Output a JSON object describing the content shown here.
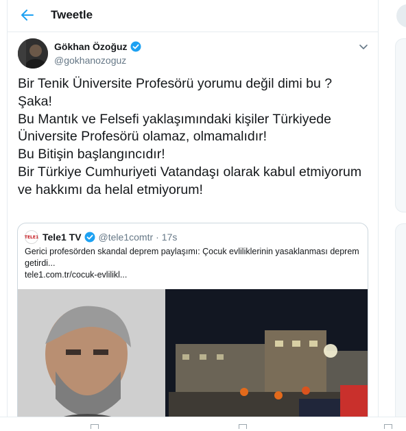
{
  "header": {
    "title": "Tweetle",
    "back_icon": "arrow-left-icon"
  },
  "tweet": {
    "author_name": "Gökhan Özoğuz",
    "author_handle": "@gokhanozoguz",
    "text": "Bir Tenik Üniversite Profesörü yorumu değil dimi bu ?\nŞaka!\nBu Mantık ve Felsefi yaklaşımındaki kişiler Türkiyede Üniversite Profesörü olamaz, olmamalıdır!\nBu Bitişin başlangıncıdır!\nBir Türkiye Cumhuriyeti Vatandaşı olarak kabul etmiyorum ve hakkımı da helal etmiyorum!"
  },
  "quote": {
    "logo_text": "TELE1",
    "name": "Tele1 TV",
    "handle": "@tele1comtr",
    "separator": "·",
    "time": "17s",
    "text": "Gerici profesörden skandal deprem paylaşımı: Çocuk evliliklerinin yasaklanması deprem getirdi...",
    "link": "tele1.com.tr/cocuk-evlilikl..."
  },
  "colors": {
    "accent": "#1da1f2",
    "text": "#14171a",
    "secondary": "#657786",
    "border": "#e6ecf0"
  }
}
